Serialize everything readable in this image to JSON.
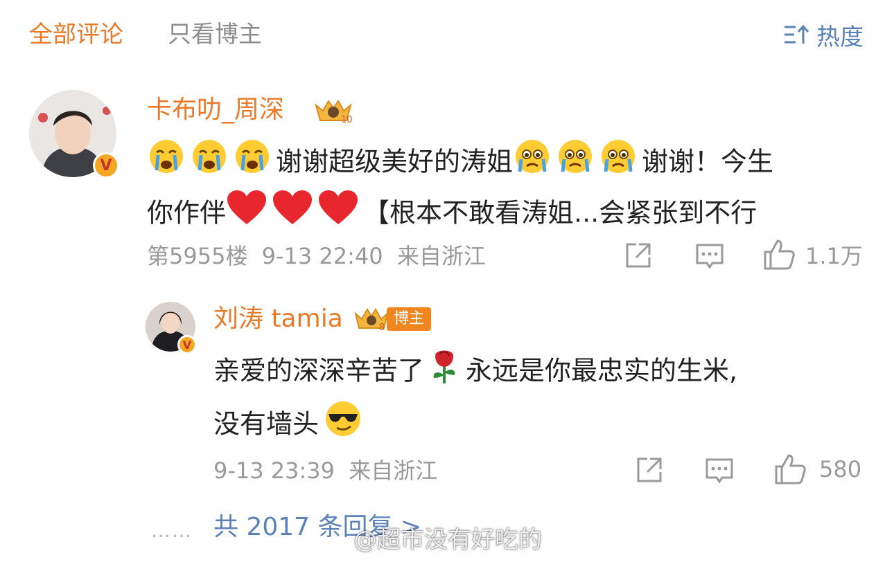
{
  "tabs": {
    "all_comments": "全部评论",
    "blogger_only": "只看博主",
    "sort_label": "热度"
  },
  "comment": {
    "username": "卡布叻_周深",
    "level_badge": "10",
    "text_line1_a": "谢谢超级美好的涛姐",
    "text_line1_b": "谢谢！今生",
    "text_line2_a": "你作伴",
    "text_line2_b": "【根本不敢看涛姐...会紧张到不行",
    "floor": "第5955楼",
    "time": "9-13 22:40",
    "location": "来自浙江",
    "likes": "1.1万",
    "icons": [
      "share-icon",
      "comment-icon",
      "like-icon"
    ]
  },
  "reply": {
    "username": "刘涛 tamia",
    "level_badge": "8",
    "blogger_tag": "博主",
    "text_line1_a": "亲爱的深深辛苦了",
    "text_line1_b": "永远是你最忠实的生米,",
    "text_line2": "没有墙头",
    "time": "9-13 23:39",
    "location": "来自浙江",
    "likes": "580"
  },
  "more_replies": "共 2017 条回复 >",
  "watermark": "@超市没有好吃的",
  "colors": {
    "accent_orange": "#ea7a28",
    "link_blue": "#5b82b8",
    "meta_gray": "#999999"
  }
}
